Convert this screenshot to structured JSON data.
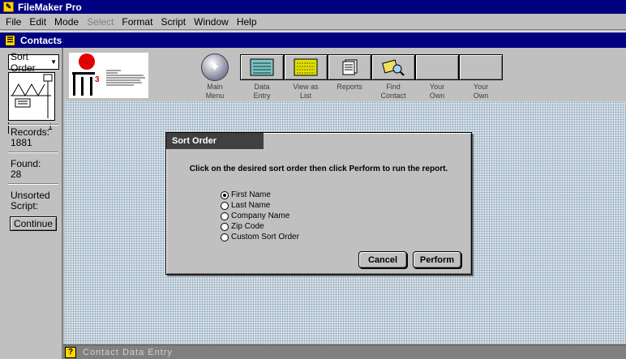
{
  "app": {
    "title": "FileMaker Pro"
  },
  "menu": {
    "file": "File",
    "edit": "Edit",
    "mode": "Mode",
    "select": "Select",
    "format": "Format",
    "script": "Script",
    "window": "Window",
    "help": "Help"
  },
  "document": {
    "title": "Contacts"
  },
  "status": {
    "layout_menu": "Sort Order",
    "page_number": "1",
    "records_label": "Records:",
    "records_value": "1881",
    "found_label": "Found:",
    "found_value": "28",
    "sort_state": "Unsorted",
    "script_label": "Script:",
    "continue_label": "Continue"
  },
  "header": {
    "main_menu": [
      "Main",
      "Menu"
    ],
    "data_entry": [
      "Data",
      "Entry"
    ],
    "view_as_list": [
      "View as",
      "List"
    ],
    "reports": [
      "Reports",
      ""
    ],
    "find_contact": [
      "Find",
      "Contact"
    ],
    "your_own_1": [
      "Your",
      "Own"
    ],
    "your_own_2": [
      "Your",
      "Own"
    ]
  },
  "dialog": {
    "title": "Sort Order",
    "instruction": "Click on the desired sort order then click Perform to run the report.",
    "options": [
      "First Name",
      "Last Name",
      "Company Name",
      "Zip Code",
      "Custom Sort Order"
    ],
    "selected_index": 0,
    "cancel_label": "Cancel",
    "perform_label": "Perform"
  },
  "bottom_bar": {
    "help_glyph": "?",
    "label": "Contact Data Entry"
  },
  "colors": {
    "title_bar": "#000080",
    "dialog_title": "#404040",
    "background": "#c0c0c0",
    "pattern": "#88b0b0"
  }
}
